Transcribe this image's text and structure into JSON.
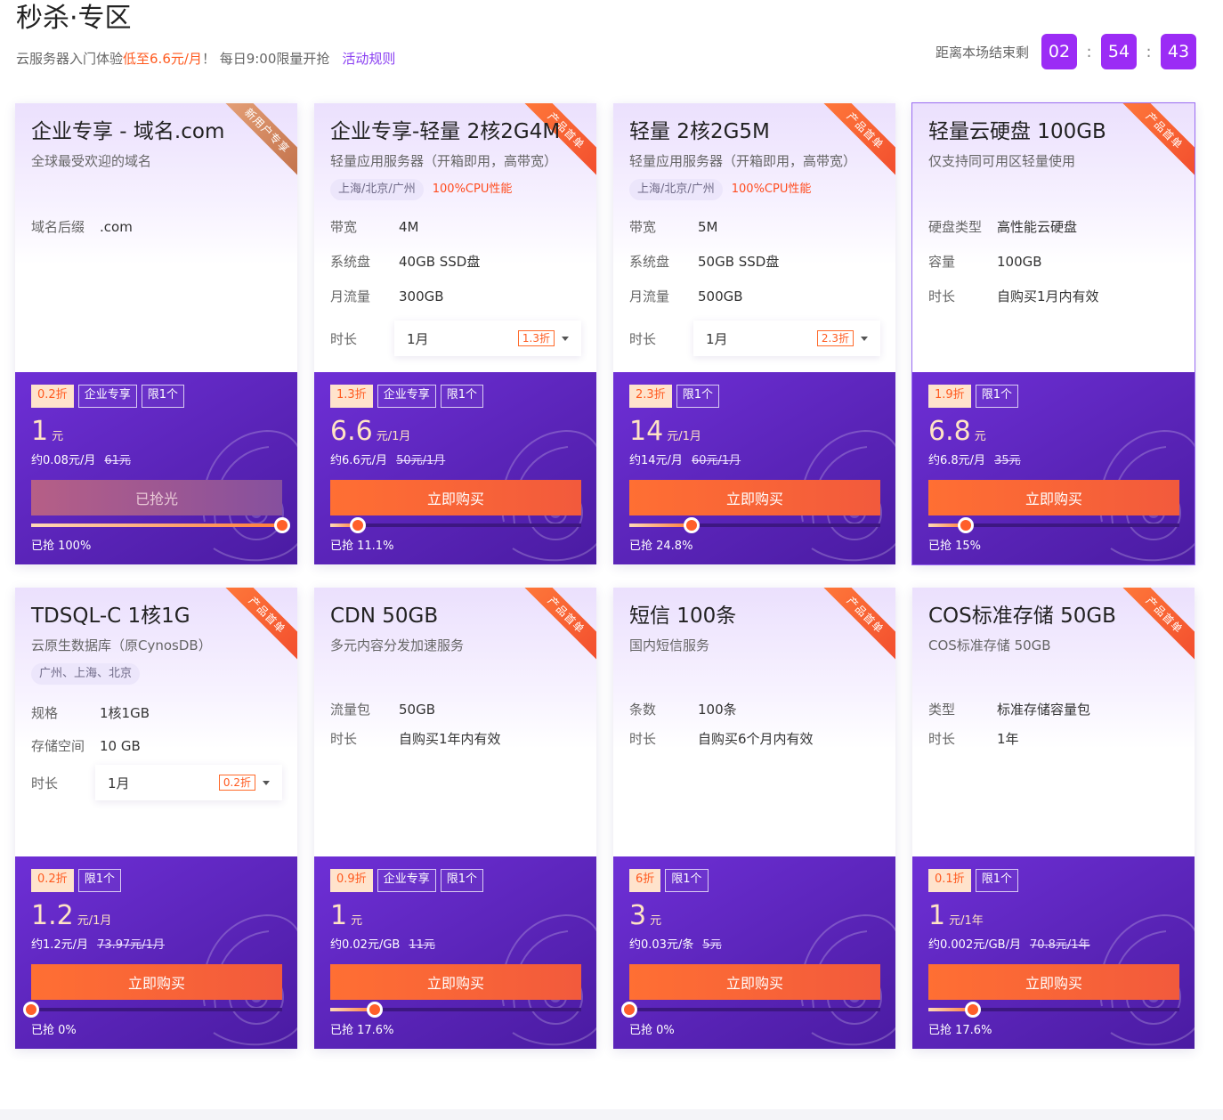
{
  "header": {
    "title": "秒杀·专区",
    "subtitle_prefix": "云服务器入门体验",
    "subtitle_highlight": "低至6.6元/月",
    "subtitle_suffix": "！ 每日9:00限量开抢",
    "rules_link": "活动规则"
  },
  "countdown": {
    "label": "距离本场结束剩",
    "hours": "02",
    "minutes": "54",
    "seconds": "43",
    "separator": ":"
  },
  "products": [
    {
      "ribbon": "新用户专享",
      "name": "企业专享 - 域名.com",
      "desc": "全球最受欢迎的域名",
      "specs": [
        {
          "k": "域名后缀",
          "v": ".com"
        }
      ],
      "badges": [
        "0.2折",
        "企业专享",
        "限1个"
      ],
      "price": "1",
      "unit": "元",
      "sub_price": "约0.08元/月",
      "orig_price": "61元",
      "button": "已抢光",
      "progress": 1.0,
      "sold": "已抢 100%"
    },
    {
      "ribbon": "产品首单",
      "name": "企业专享-轻量 2核2G4M",
      "desc": "轻量应用服务器（开箱即用，高带宽）",
      "region": "上海/北京/广州",
      "perf": "100%CPU性能",
      "specs": [
        {
          "k": "带宽",
          "v": "4M"
        },
        {
          "k": "系统盘",
          "v": "40GB SSD盘"
        },
        {
          "k": "月流量",
          "v": "300GB"
        }
      ],
      "duration_label": "时长",
      "duration": "1月",
      "duration_discount": "1.3折",
      "badges": [
        "1.3折",
        "企业专享",
        "限1个"
      ],
      "price": "6.6",
      "unit": "元/1月",
      "sub_price": "约6.6元/月",
      "orig_price": "50元/1月",
      "button": "立即购买",
      "progress": 0.111,
      "sold": "已抢 11.1%"
    },
    {
      "ribbon": "产品首单",
      "name": "轻量 2核2G5M",
      "desc": "轻量应用服务器（开箱即用，高带宽）",
      "region": "上海/北京/广州",
      "perf": "100%CPU性能",
      "specs": [
        {
          "k": "带宽",
          "v": "5M"
        },
        {
          "k": "系统盘",
          "v": "50GB SSD盘"
        },
        {
          "k": "月流量",
          "v": "500GB"
        }
      ],
      "duration_label": "时长",
      "duration": "1月",
      "duration_discount": "2.3折",
      "badges": [
        "2.3折",
        "限1个"
      ],
      "price": "14",
      "unit": "元/1月",
      "sub_price": "约14元/月",
      "orig_price": "60元/1月",
      "button": "立即购买",
      "progress": 0.248,
      "sold": "已抢 24.8%"
    },
    {
      "ribbon": "产品首单",
      "name": "轻量云硬盘 100GB",
      "desc": "仅支持同可用区轻量使用",
      "specs": [
        {
          "k": "硬盘类型",
          "v": "高性能云硬盘"
        },
        {
          "k": "容量",
          "v": "100GB"
        },
        {
          "k": "时长",
          "v": "自购买1月内有效"
        }
      ],
      "badges": [
        "1.9折",
        "限1个"
      ],
      "price": "6.8",
      "unit": "元",
      "sub_price": "约6.8元/月",
      "orig_price": "35元",
      "button": "立即购买",
      "progress": 0.15,
      "sold": "已抢 15%"
    },
    {
      "ribbon": "产品首单",
      "name": "TDSQL-C 1核1G",
      "desc": "云原生数据库（原CynosDB）",
      "region": "广州、上海、北京",
      "specs": [
        {
          "k": "规格",
          "v": "1核1GB"
        },
        {
          "k": "存储空间",
          "v": "10 GB"
        }
      ],
      "duration_label": "时长",
      "duration": "1月",
      "duration_discount": "0.2折",
      "badges": [
        "0.2折",
        "限1个"
      ],
      "price": "1.2",
      "unit": "元/1月",
      "sub_price": "约1.2元/月",
      "orig_price": "73.97元/1月",
      "button": "立即购买",
      "progress": 0.0,
      "sold": "已抢 0%"
    },
    {
      "ribbon": "产品首单",
      "name": "CDN 50GB",
      "desc": "多元内容分发加速服务",
      "specs": [
        {
          "k": "流量包",
          "v": "50GB"
        },
        {
          "k": "时长",
          "v": "自购买1年内有效"
        }
      ],
      "badges": [
        "0.9折",
        "企业专享",
        "限1个"
      ],
      "price": "1",
      "unit": "元",
      "sub_price": "约0.02元/GB",
      "orig_price": "11元",
      "button": "立即购买",
      "progress": 0.176,
      "sold": "已抢 17.6%"
    },
    {
      "ribbon": "产品首单",
      "name": "短信 100条",
      "desc": "国内短信服务",
      "specs": [
        {
          "k": "条数",
          "v": "100条"
        },
        {
          "k": "时长",
          "v": "自购买6个月内有效"
        }
      ],
      "badges": [
        "6折",
        "限1个"
      ],
      "price": "3",
      "unit": "元",
      "sub_price": "约0.03元/条",
      "orig_price": "5元",
      "button": "立即购买",
      "progress": 0.0,
      "sold": "已抢 0%"
    },
    {
      "ribbon": "产品首单",
      "name": "COS标准存储 50GB",
      "desc": "COS标准存储 50GB",
      "specs": [
        {
          "k": "类型",
          "v": "标准存储容量包"
        },
        {
          "k": "时长",
          "v": "1年"
        }
      ],
      "badges": [
        "0.1折",
        "限1个"
      ],
      "price": "1",
      "unit": "元/1年",
      "sub_price": "约0.002元/GB/月",
      "orig_price": "70.8元/1年",
      "button": "立即购买",
      "progress": 0.176,
      "sold": "已抢 17.6%"
    }
  ]
}
